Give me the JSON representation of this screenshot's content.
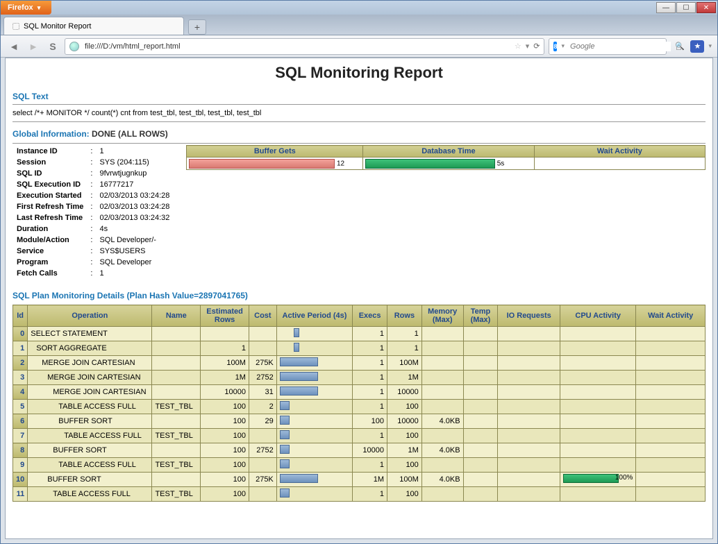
{
  "browser": {
    "app_button": "Firefox",
    "tab_title": "SQL Monitor Report",
    "url": "file:///D:/vm/html_report.html",
    "search_placeholder": "Google"
  },
  "report": {
    "title": "SQL Monitoring Report",
    "sql_text_label": "SQL Text",
    "sql_text": "select /*+ MONITOR */ count(*) cnt from test_tbl, test_tbl, test_tbl, test_tbl",
    "global_label": "Global Information:",
    "global_status": "DONE (ALL ROWS)",
    "info": [
      {
        "k": "Instance ID",
        "v": "1"
      },
      {
        "k": "Session",
        "v": "SYS (204:115)"
      },
      {
        "k": "SQL ID",
        "v": "9fvrwtjugnkup"
      },
      {
        "k": "SQL Execution ID",
        "v": "16777217"
      },
      {
        "k": "Execution Started",
        "v": "02/03/2013 03:24:28"
      },
      {
        "k": "First Refresh Time",
        "v": "02/03/2013 03:24:28"
      },
      {
        "k": "Last Refresh Time",
        "v": "02/03/2013 03:24:32"
      },
      {
        "k": "Duration",
        "v": "4s"
      },
      {
        "k": "Module/Action",
        "v": "SQL Developer/-"
      },
      {
        "k": "Service",
        "v": "SYS$USERS"
      },
      {
        "k": "Program",
        "v": "SQL Developer"
      },
      {
        "k": "Fetch Calls",
        "v": "1"
      }
    ],
    "metric_headers": [
      "Buffer Gets",
      "Database Time",
      "Wait Activity"
    ],
    "metric_values": {
      "buffer_gets": "12",
      "db_time": "5s"
    },
    "plan_title": "SQL Plan Monitoring Details (Plan Hash Value=2897041765)",
    "plan_headers": [
      "Id",
      "Operation",
      "Name",
      "Estimated Rows",
      "Cost",
      "Active Period (4s)",
      "Execs",
      "Rows",
      "Memory (Max)",
      "Temp (Max)",
      "IO Requests",
      "CPU Activity",
      "Wait Activity"
    ],
    "plan_rows": [
      {
        "id": "0",
        "op": "SELECT STATEMENT",
        "indent": 0,
        "name": "",
        "est": "",
        "cost": "",
        "p_off": 20,
        "p_w": 8,
        "execs": "1",
        "rows": "1",
        "mem": "",
        "temp": "",
        "io": "",
        "cpu": "",
        "cpu_txt": ""
      },
      {
        "id": "1",
        "op": "SORT AGGREGATE",
        "indent": 1,
        "name": "",
        "est": "1",
        "cost": "",
        "p_off": 20,
        "p_w": 8,
        "execs": "1",
        "rows": "1",
        "mem": "",
        "temp": "",
        "io": "",
        "cpu": "",
        "cpu_txt": ""
      },
      {
        "id": "2",
        "op": "MERGE JOIN CARTESIAN",
        "indent": 2,
        "name": "",
        "est": "100M",
        "cost": "275K",
        "p_off": 0,
        "p_w": 55,
        "execs": "1",
        "rows": "100M",
        "mem": "",
        "temp": "",
        "io": "",
        "cpu": "",
        "cpu_txt": ""
      },
      {
        "id": "3",
        "op": "MERGE JOIN CARTESIAN",
        "indent": 3,
        "name": "",
        "est": "1M",
        "cost": "2752",
        "p_off": 0,
        "p_w": 55,
        "execs": "1",
        "rows": "1M",
        "mem": "",
        "temp": "",
        "io": "",
        "cpu": "",
        "cpu_txt": ""
      },
      {
        "id": "4",
        "op": "MERGE JOIN CARTESIAN",
        "indent": 4,
        "name": "",
        "est": "10000",
        "cost": "31",
        "p_off": 0,
        "p_w": 55,
        "execs": "1",
        "rows": "10000",
        "mem": "",
        "temp": "",
        "io": "",
        "cpu": "",
        "cpu_txt": ""
      },
      {
        "id": "5",
        "op": "TABLE ACCESS FULL",
        "indent": 5,
        "name": "TEST_TBL",
        "est": "100",
        "cost": "2",
        "p_off": 0,
        "p_w": 14,
        "execs": "1",
        "rows": "100",
        "mem": "",
        "temp": "",
        "io": "",
        "cpu": "",
        "cpu_txt": ""
      },
      {
        "id": "6",
        "op": "BUFFER SORT",
        "indent": 5,
        "name": "",
        "est": "100",
        "cost": "29",
        "p_off": 0,
        "p_w": 14,
        "execs": "100",
        "rows": "10000",
        "mem": "4.0KB",
        "temp": "",
        "io": "",
        "cpu": "",
        "cpu_txt": ""
      },
      {
        "id": "7",
        "op": "TABLE ACCESS FULL",
        "indent": 6,
        "name": "TEST_TBL",
        "est": "100",
        "cost": "",
        "p_off": 0,
        "p_w": 14,
        "execs": "1",
        "rows": "100",
        "mem": "",
        "temp": "",
        "io": "",
        "cpu": "",
        "cpu_txt": ""
      },
      {
        "id": "8",
        "op": "BUFFER SORT",
        "indent": 4,
        "name": "",
        "est": "100",
        "cost": "2752",
        "p_off": 0,
        "p_w": 14,
        "execs": "10000",
        "rows": "1M",
        "mem": "4.0KB",
        "temp": "",
        "io": "",
        "cpu": "",
        "cpu_txt": ""
      },
      {
        "id": "9",
        "op": "TABLE ACCESS FULL",
        "indent": 5,
        "name": "TEST_TBL",
        "est": "100",
        "cost": "",
        "p_off": 0,
        "p_w": 14,
        "execs": "1",
        "rows": "100",
        "mem": "",
        "temp": "",
        "io": "",
        "cpu": "",
        "cpu_txt": ""
      },
      {
        "id": "10",
        "op": "BUFFER SORT",
        "indent": 3,
        "name": "",
        "est": "100",
        "cost": "275K",
        "p_off": 0,
        "p_w": 55,
        "execs": "1M",
        "rows": "100M",
        "mem": "4.0KB",
        "temp": "",
        "io": "",
        "cpu": "80",
        "cpu_txt": "100%"
      },
      {
        "id": "11",
        "op": "TABLE ACCESS FULL",
        "indent": 4,
        "name": "TEST_TBL",
        "est": "100",
        "cost": "",
        "p_off": 0,
        "p_w": 14,
        "execs": "1",
        "rows": "100",
        "mem": "",
        "temp": "",
        "io": "",
        "cpu": "",
        "cpu_txt": ""
      }
    ]
  }
}
